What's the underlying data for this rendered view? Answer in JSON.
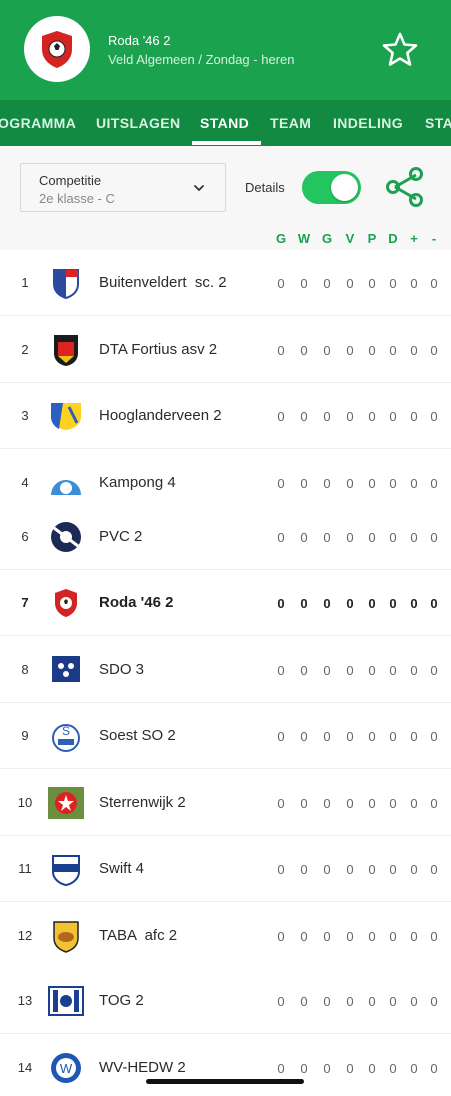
{
  "header": {
    "club_name": "Roda '46 2",
    "subtitle": "Veld Algemeen / Zondag - heren",
    "favorite_icon": "star-outline-icon",
    "colors": {
      "primary": "#1aa24f",
      "tab_bar": "#128a42"
    }
  },
  "tabs": [
    {
      "label": "OGRAMMA",
      "active": false
    },
    {
      "label": "UITSLAGEN",
      "active": false
    },
    {
      "label": "STAND",
      "active": true
    },
    {
      "label": "TEAM",
      "active": false
    },
    {
      "label": "INDELING",
      "active": false
    },
    {
      "label": "STA",
      "active": false
    }
  ],
  "controls": {
    "select_label": "Competitie",
    "select_value": "2e klasse - C",
    "details_label": "Details",
    "details_on": true,
    "share_icon": "share-icon"
  },
  "columns": [
    "G",
    "W",
    "G",
    "V",
    "P",
    "D",
    "+",
    "-"
  ],
  "standings": [
    {
      "rank": "1",
      "team": "Buitenveldert  sc. 2",
      "logo": "bvt-shield",
      "stats": [
        "0",
        "0",
        "0",
        "0",
        "0",
        "0",
        "0",
        "0"
      ],
      "highlight": false
    },
    {
      "rank": "2",
      "team": "DTA Fortius asv 2",
      "logo": "dta-fortius-shield",
      "stats": [
        "0",
        "0",
        "0",
        "0",
        "0",
        "0",
        "0",
        "0"
      ],
      "highlight": false
    },
    {
      "rank": "3",
      "team": "Hooglanderveen 2",
      "logo": "vvh-shield",
      "stats": [
        "0",
        "0",
        "0",
        "0",
        "0",
        "0",
        "0",
        "0"
      ],
      "highlight": false
    },
    {
      "rank": "4",
      "team": "Kampong 4",
      "logo": "kampong-ball",
      "stats": [
        "0",
        "0",
        "0",
        "0",
        "0",
        "0",
        "0",
        "0"
      ],
      "highlight": false
    },
    {
      "rank": "6",
      "team": "PVC 2",
      "logo": "pvc-round",
      "stats": [
        "0",
        "0",
        "0",
        "0",
        "0",
        "0",
        "0",
        "0"
      ],
      "highlight": false
    },
    {
      "rank": "7",
      "team": "Roda '46 2",
      "logo": "roda-shield",
      "stats": [
        "0",
        "0",
        "0",
        "0",
        "0",
        "0",
        "0",
        "0"
      ],
      "highlight": true
    },
    {
      "rank": "8",
      "team": "SDO 3",
      "logo": "sdo-shield",
      "stats": [
        "0",
        "0",
        "0",
        "0",
        "0",
        "0",
        "0",
        "0"
      ],
      "highlight": false
    },
    {
      "rank": "9",
      "team": "Soest SO 2",
      "logo": "soest-round",
      "stats": [
        "0",
        "0",
        "0",
        "0",
        "0",
        "0",
        "0",
        "0"
      ],
      "highlight": false
    },
    {
      "rank": "10",
      "team": "Sterrenwijk 2",
      "logo": "sterrenwijk-square",
      "stats": [
        "0",
        "0",
        "0",
        "0",
        "0",
        "0",
        "0",
        "0"
      ],
      "highlight": false
    },
    {
      "rank": "11",
      "team": "Swift 4",
      "logo": "swift-shield",
      "stats": [
        "0",
        "0",
        "0",
        "0",
        "0",
        "0",
        "0",
        "0"
      ],
      "highlight": false
    },
    {
      "rank": "12",
      "team": "TABA  afc 2",
      "logo": "taba-shield",
      "stats": [
        "0",
        "0",
        "0",
        "0",
        "0",
        "0",
        "0",
        "0"
      ],
      "highlight": false
    },
    {
      "rank": "13",
      "team": "TOG 2",
      "logo": "tog-shield",
      "stats": [
        "0",
        "0",
        "0",
        "0",
        "0",
        "0",
        "0",
        "0"
      ],
      "highlight": false
    },
    {
      "rank": "14",
      "team": "WV-HEDW 2",
      "logo": "wv-hedw-round",
      "stats": [
        "0",
        "0",
        "0",
        "0",
        "0",
        "0",
        "0",
        "0"
      ],
      "highlight": false
    }
  ]
}
